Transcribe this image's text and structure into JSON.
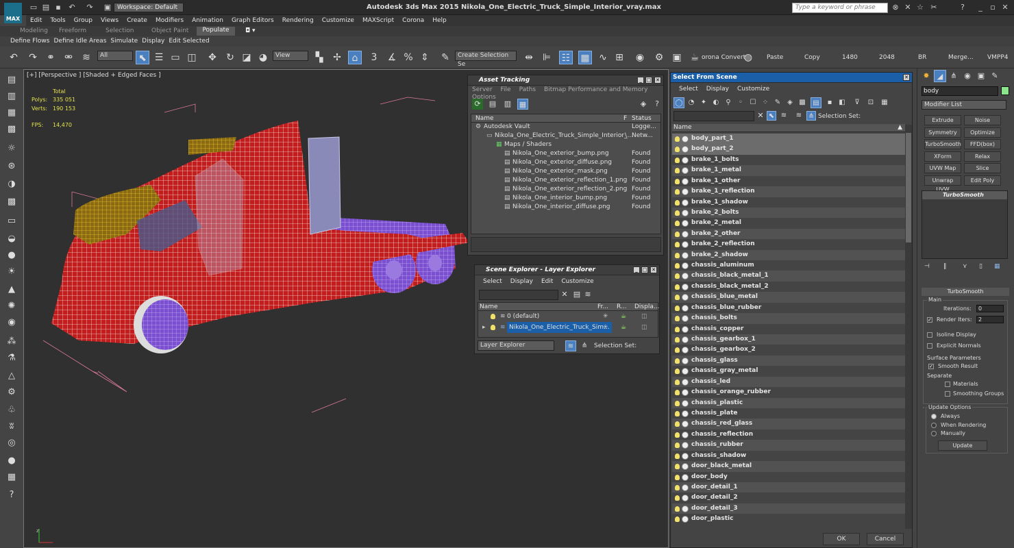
{
  "titlebar": {
    "app_title": "Autodesk 3ds Max  2015     Nikola_One_Electric_Truck_Simple_Interior_vray.max",
    "workspace": "Workspace: Default",
    "search_placeholder": "Type a keyword or phrase",
    "logo": "MAX"
  },
  "menu": [
    "Edit",
    "Tools",
    "Group",
    "Views",
    "Create",
    "Modifiers",
    "Animation",
    "Graph Editors",
    "Rendering",
    "Customize",
    "MAXScript",
    "Corona",
    "Help"
  ],
  "ribbon_tabs": [
    "Modeling",
    "Freeform",
    "Selection",
    "Object Paint",
    "Populate"
  ],
  "ribbon2": [
    "Define Flows",
    "Define Idle Areas",
    "Simulate",
    "Display",
    "Edit Selected"
  ],
  "toolbar": {
    "filter": "All",
    "view": "View",
    "selection_set": "Create Selection Se",
    "corona_convert": "orona Convert",
    "paste": "Paste",
    "copy": "Copy",
    "w1480": "1480",
    "w2048": "2048",
    "br": "BR",
    "merge": "Merge...",
    "vmpp4": "VMPP4"
  },
  "viewport": {
    "label": "[+] [Perspective ] [Shaded + Edged Faces ]",
    "stats": {
      "total": "Total",
      "polys_label": "Polys:",
      "polys": "335 051",
      "verts_label": "Verts:",
      "verts": "190 153",
      "fps_label": "FPS:",
      "fps": "14,470"
    }
  },
  "asset_tracking": {
    "title": "Asset Tracking",
    "menu": [
      "Server",
      "File",
      "Paths",
      "Bitmap Performance and Memory",
      "Options"
    ],
    "cols": [
      "Name",
      "F",
      "Status"
    ],
    "rows": [
      {
        "name": "Autodesk Vault",
        "f": "",
        "status": "Logge...",
        "indent": 18
      },
      {
        "name": "Nikola_One_Electric_Truck_Simple_Interior_...",
        "f": "\\",
        "status": "Netw...",
        "indent": 34
      },
      {
        "name": "Maps / Shaders",
        "f": "",
        "status": "",
        "indent": 48
      },
      {
        "name": "Nikola_One_exterior_bump.png",
        "f": "",
        "status": "Found",
        "indent": 60
      },
      {
        "name": "Nikola_One_exterior_diffuse.png",
        "f": "",
        "status": "Found",
        "indent": 60
      },
      {
        "name": "Nikola_One_exterior_mask.png",
        "f": "",
        "status": "Found",
        "indent": 60
      },
      {
        "name": "Nikola_One_exterior_reflection_1.png",
        "f": "",
        "status": "Found",
        "indent": 60
      },
      {
        "name": "Nikola_One_exterior_reflection_2.png",
        "f": "",
        "status": "Found",
        "indent": 60
      },
      {
        "name": "Nikola_One_interior_bump.png",
        "f": "",
        "status": "Found",
        "indent": 60
      },
      {
        "name": "Nikola_One_interior_diffuse.png",
        "f": "",
        "status": "Found",
        "indent": 60
      }
    ]
  },
  "scene_explorer": {
    "title": "Scene Explorer - Layer Explorer",
    "menu": [
      "Select",
      "Display",
      "Edit",
      "Customize"
    ],
    "cols": [
      "Name",
      "Fr...",
      "R...",
      "Displa..."
    ],
    "rows": [
      "0 (default)",
      "Nikola_One_Electric_Truck_Sim..."
    ],
    "footer_combo": "Layer Explorer",
    "selection_set": "Selection Set:"
  },
  "select_from_scene": {
    "title": "Select From Scene",
    "menu": [
      "Select",
      "Display",
      "Customize"
    ],
    "selection_set": "Selection Set:",
    "col_name": "Name",
    "objects": [
      "body_part_1",
      "body_part_2",
      "brake_1_bolts",
      "brake_1_metal",
      "brake_1_other",
      "brake_1_reflection",
      "brake_1_shadow",
      "brake_2_bolts",
      "brake_2_metal",
      "brake_2_other",
      "brake_2_reflection",
      "brake_2_shadow",
      "chassis_aluminum",
      "chassis_black_metal_1",
      "chassis_black_metal_2",
      "chassis_blue_metal",
      "chassis_blue_rubber",
      "chassis_bolts",
      "chassis_copper",
      "chassis_gearbox_1",
      "chassis_gearbox_2",
      "chassis_glass",
      "chassis_gray_metal",
      "chassis_led",
      "chassis_orange_rubber",
      "chassis_plastic",
      "chassis_plate",
      "chassis_red_glass",
      "chassis_reflection",
      "chassis_rubber",
      "chassis_shadow",
      "door_black_metal",
      "door_body",
      "door_detail_1",
      "door_detail_2",
      "door_detail_3",
      "door_plastic"
    ],
    "ok": "OK",
    "cancel": "Cancel"
  },
  "command_panel": {
    "object_name": "body",
    "modifier_list": "Modifier List",
    "modifier_buttons": [
      "Extrude",
      "Noise",
      "Symmetry",
      "Optimize",
      "TurboSmooth",
      "FFD(box)",
      "XForm",
      "Relax",
      "UVW Map",
      "Slice",
      "Unwrap UVW",
      "Edit Poly"
    ],
    "stack_item": "TurboSmooth",
    "rollout": "TurboSmooth",
    "main": "Main",
    "iterations_label": "Iterations:",
    "iterations": "0",
    "render_iters_label": "Render Iters:",
    "render_iters": "2",
    "isoline": "Isoline Display",
    "explicit": "Explicit Normals",
    "surface": "Surface Parameters",
    "smooth_result": "Smooth Result",
    "separate": "Separate",
    "materials": "Materials",
    "smoothing_groups": "Smoothing Groups",
    "update_options": "Update Options",
    "always": "Always",
    "when_rendering": "When Rendering",
    "manually": "Manually",
    "update": "Update"
  }
}
